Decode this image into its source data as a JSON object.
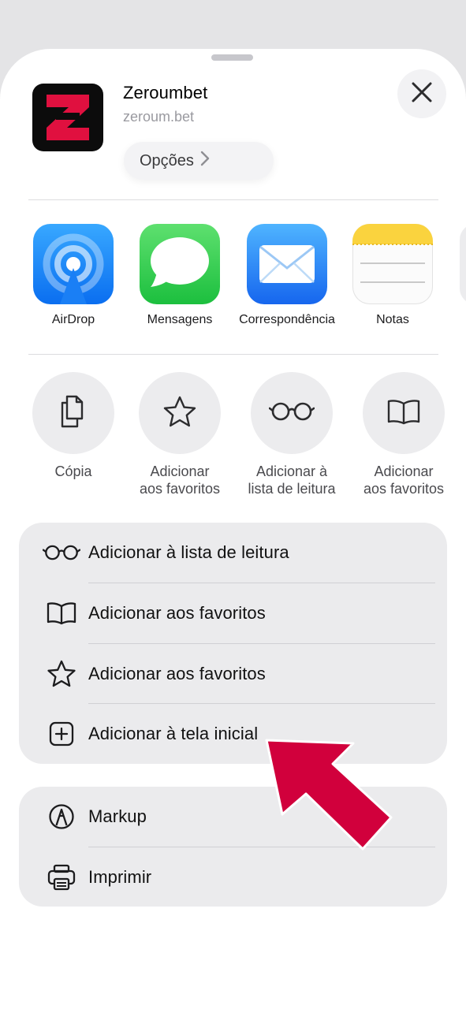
{
  "header": {
    "app_name": "Zeroumbet",
    "app_url": "zeroum.bet",
    "options_label": "Opções",
    "logo_letter": "Z",
    "logo_icon": "zeroumbet-logo",
    "close_icon": "close-icon"
  },
  "apps": [
    {
      "label": "AirDrop",
      "icon": "airdrop-icon",
      "color": "#1a8cf5"
    },
    {
      "label": "Mensagens",
      "icon": "messages-icon",
      "color": "#34c759"
    },
    {
      "label": "Correspondência",
      "icon": "mail-icon",
      "color": "#1e88f3"
    },
    {
      "label": "Notas",
      "icon": "notes-icon",
      "color": "#f9cf3a"
    }
  ],
  "actions": [
    {
      "line1": "Cópia",
      "line2": "",
      "icon": "copy-icon"
    },
    {
      "line1": "Adicionar",
      "line2": "aos favoritos",
      "icon": "star-icon"
    },
    {
      "line1": "Adicionar à",
      "line2": "lista de leitura",
      "icon": "glasses-icon"
    },
    {
      "line1": "Adicionar",
      "line2": "aos favoritos",
      "icon": "book-icon"
    }
  ],
  "menu_group_1": [
    {
      "label": "Adicionar à lista de leitura",
      "icon": "glasses-icon"
    },
    {
      "label": "Adicionar aos favoritos",
      "icon": "book-icon"
    },
    {
      "label": "Adicionar aos favoritos",
      "icon": "star-icon"
    },
    {
      "label": "Adicionar à tela inicial",
      "icon": "plus-square-icon"
    }
  ],
  "menu_group_2": [
    {
      "label": "Markup",
      "icon": "markup-icon"
    },
    {
      "label": "Imprimir",
      "icon": "printer-icon"
    }
  ],
  "colors": {
    "highlight_arrow": "#d1003c",
    "logo_red": "#e0103f"
  }
}
